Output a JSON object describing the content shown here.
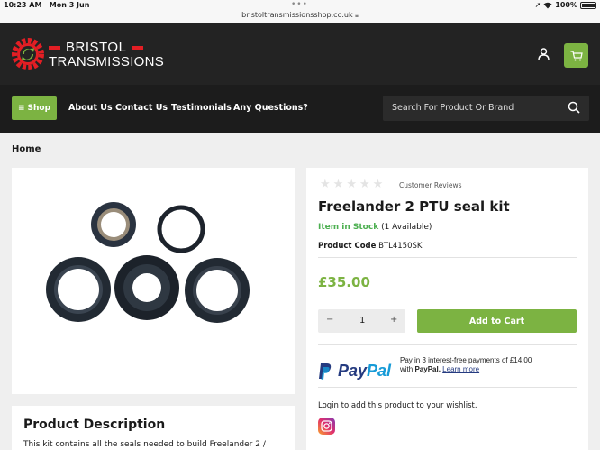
{
  "status": {
    "time": "10:23 AM",
    "date": "Mon 3 Jun",
    "battery": "100%",
    "url": "bristoltransmissionsshop.co.uk"
  },
  "header": {
    "brand_line1": "BRISTOL",
    "brand_line2": "TRANSMISSIONS",
    "brand_red": "#e31e24",
    "accent": "#7cb342"
  },
  "nav": {
    "shop_label": "Shop",
    "links": [
      "About Us",
      "Contact Us",
      "Testimonials",
      "Any Questions?"
    ],
    "search_placeholder": "Search For Product Or Brand"
  },
  "breadcrumb": "Home",
  "product": {
    "review_label": "Customer Reviews",
    "rating": 0,
    "title": "Freelander 2 PTU seal kit",
    "stock_label": "Item in Stock",
    "stock_count": "(1 Available)",
    "code_label": "Product Code",
    "code": "BTL4150SK",
    "price": "£35.00",
    "quantity": "1",
    "add_to_cart": "Add to Cart",
    "paypal": {
      "line1": "Pay in 3 interest-free payments of £14.00",
      "with": "with",
      "brand": "PayPal.",
      "learn_more": "Learn more"
    },
    "wishlist_text": "Login to add this product to your wishlist."
  },
  "description": {
    "title": "Product Description",
    "text": "This kit contains all the seals needed to build Freelander 2 /"
  }
}
